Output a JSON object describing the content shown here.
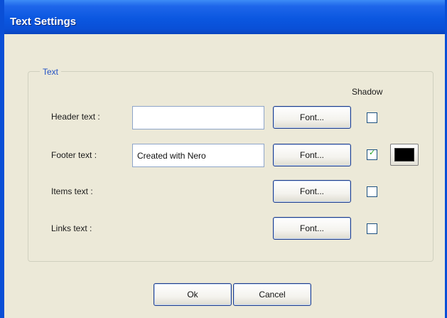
{
  "window": {
    "title": "Text Settings"
  },
  "group": {
    "legend": "Text",
    "shadow_header": "Shadow",
    "rows": [
      {
        "label": "Header text :",
        "value": "",
        "font_label": "Font...",
        "shadow_checked": false
      },
      {
        "label": "Footer text :",
        "value": "Created with Nero",
        "font_label": "Font...",
        "shadow_checked": true,
        "shadow_color": "#000000"
      },
      {
        "label": "Items text :",
        "font_label": "Font...",
        "shadow_checked": false
      },
      {
        "label": "Links text :",
        "font_label": "Font...",
        "shadow_checked": false
      }
    ]
  },
  "buttons": {
    "ok": "Ok",
    "cancel": "Cancel"
  },
  "colors": {
    "title_bar": "#0a4fd6",
    "dialog_bg": "#ece9d8",
    "legend_text": "#2452c4"
  },
  "check_glyph": "✓"
}
